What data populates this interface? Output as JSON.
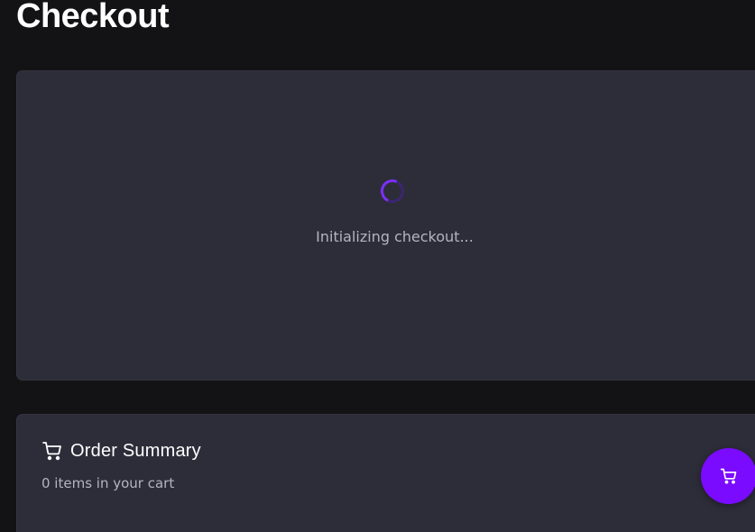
{
  "page": {
    "title": "Checkout"
  },
  "checkout": {
    "loading_text": "Initializing checkout...",
    "spinner_color": "#7b2ff7"
  },
  "order_summary": {
    "icon": "cart-icon",
    "title": "Order Summary",
    "subtitle": "0 items in your cart"
  },
  "cart_fab": {
    "icon": "cart-icon",
    "color": "#7a0bff"
  }
}
